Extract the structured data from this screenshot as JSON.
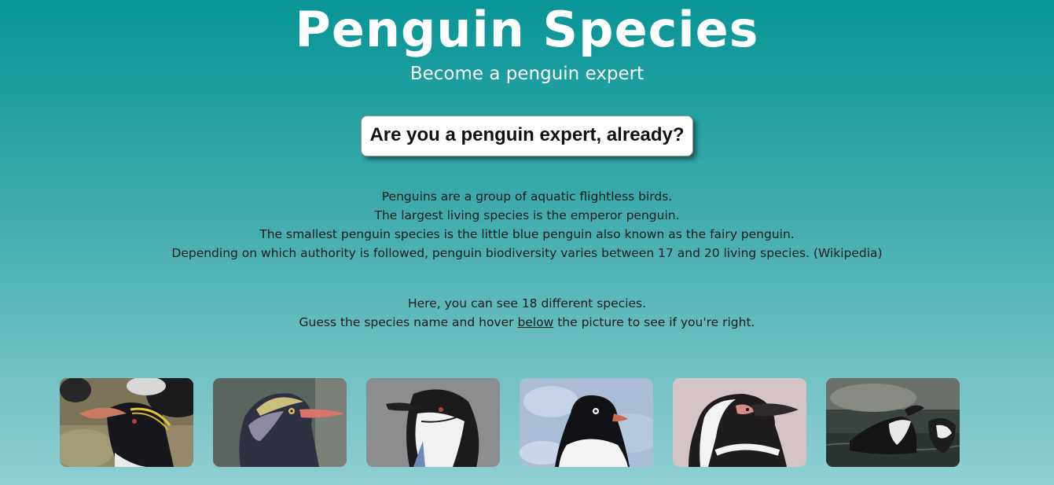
{
  "header": {
    "title": "Penguin Species",
    "subtitle": "Become a penguin expert"
  },
  "quiz": {
    "button_label": "Are you a penguin expert, already?"
  },
  "intro": {
    "lines": [
      "Penguins are a group of aquatic flightless birds.",
      "The largest living species is the emperor penguin.",
      "The smallest penguin species is the little blue penguin also known as the fairy penguin.",
      "Depending on which authority is followed, penguin biodiversity varies between 17 and 20 living species. (Wikipedia)"
    ]
  },
  "guess": {
    "line1": "Here, you can see 18 different species.",
    "line2_before": "Guess the species name and hover ",
    "line2_link": "below",
    "line2_after": " the picture to see if you're right."
  },
  "gallery": {
    "photos": [
      {
        "subject": "crested-penguin-photo"
      },
      {
        "subject": "yellow-eyed-penguin-photo"
      },
      {
        "subject": "chinstrap-penguin-photo"
      },
      {
        "subject": "adelie-penguin-photo"
      },
      {
        "subject": "magellanic-penguin-photo"
      },
      {
        "subject": "swimming-penguin-photo"
      }
    ]
  },
  "colors": {
    "background_top": "#089596",
    "background_bottom": "#8fcfd2",
    "title_text": "#ffffff",
    "body_text": "#1a1a1a"
  }
}
